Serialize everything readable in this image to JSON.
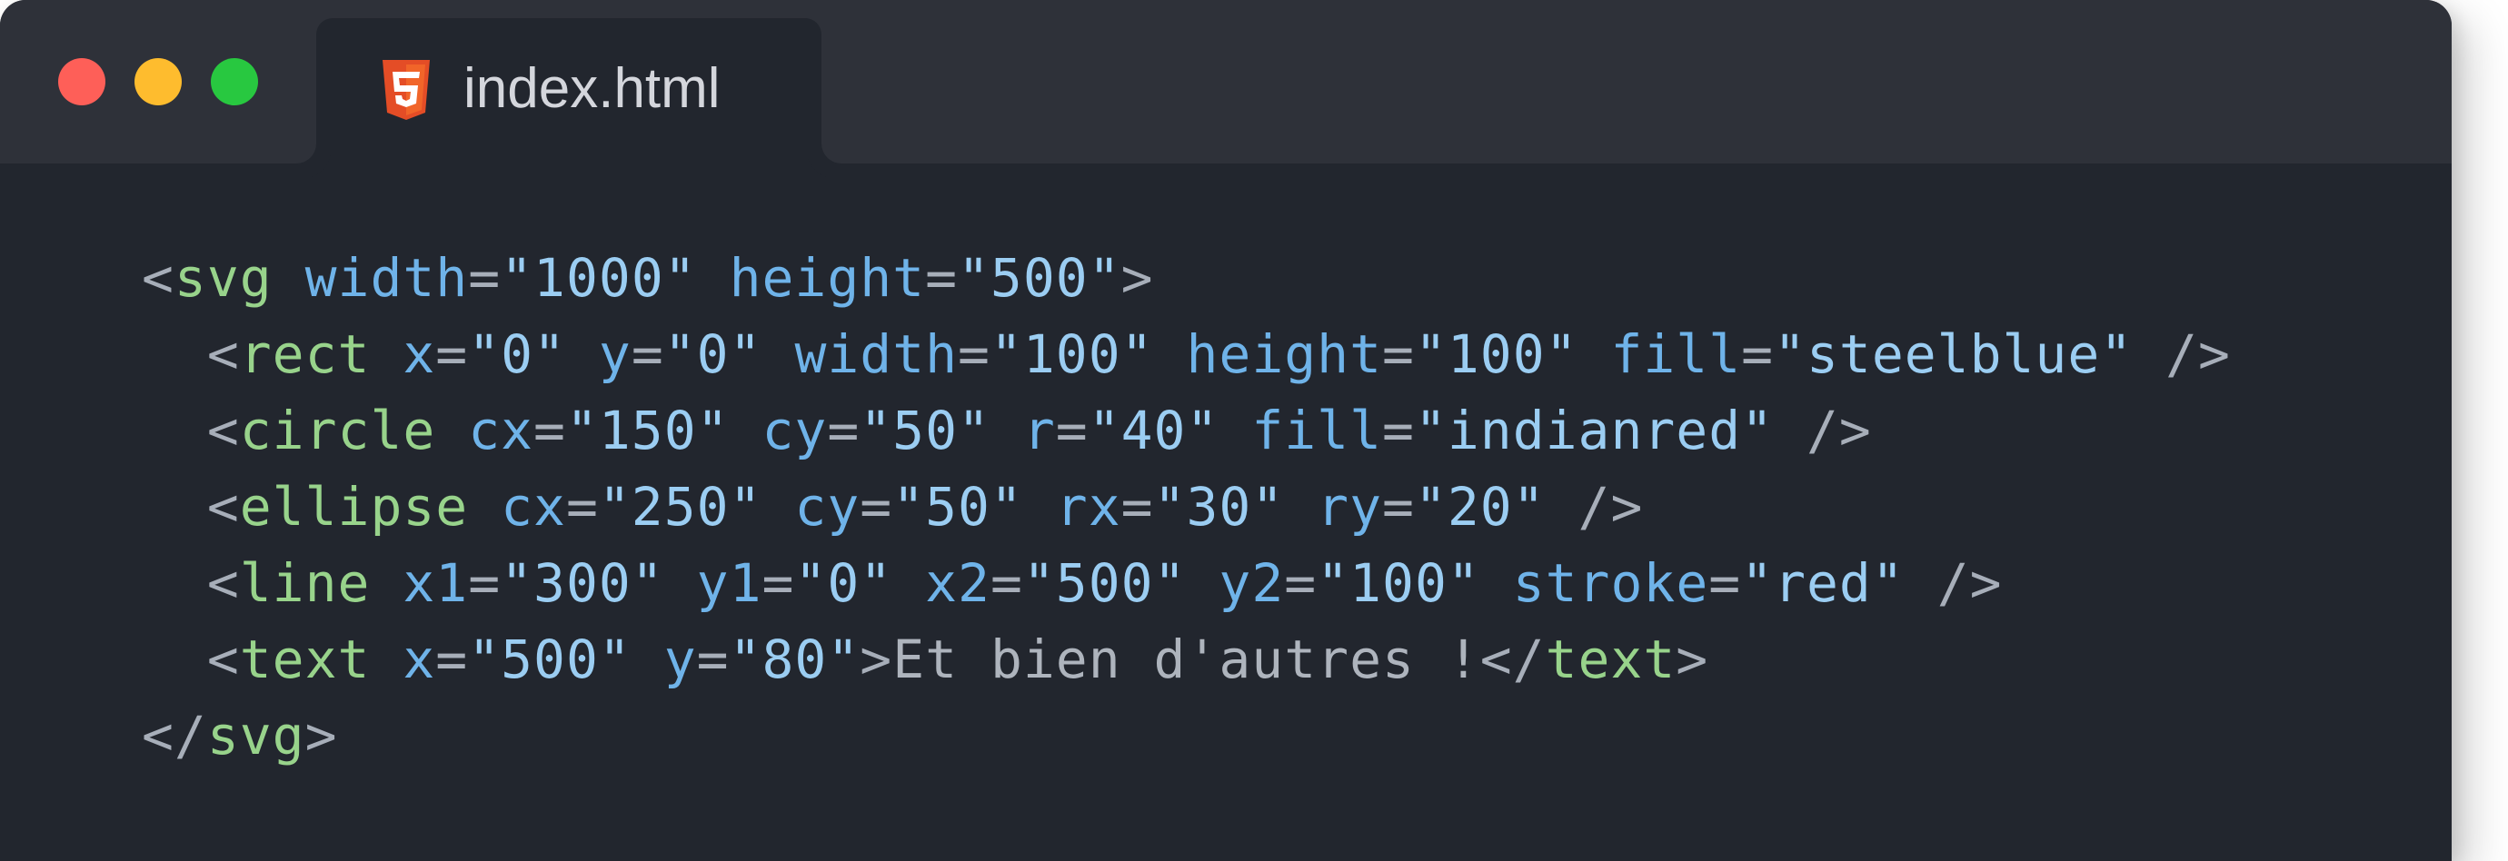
{
  "window": {
    "controls": [
      "close",
      "minimize",
      "maximize"
    ],
    "colors": {
      "close": "#fe5f58",
      "minimize": "#febc2e",
      "maximize": "#28c840",
      "background": "#22262e",
      "titlebar": "#2e3139"
    }
  },
  "tab": {
    "icon": "html5-icon",
    "title": "index.html"
  },
  "code": {
    "lines": [
      [
        {
          "k": "p",
          "v": "<"
        },
        {
          "k": "t",
          "v": "svg"
        },
        {
          "k": "x",
          "v": " "
        },
        {
          "k": "a",
          "v": "width"
        },
        {
          "k": "p",
          "v": "="
        },
        {
          "k": "s",
          "v": "\"1000\""
        },
        {
          "k": "x",
          "v": " "
        },
        {
          "k": "a",
          "v": "height"
        },
        {
          "k": "p",
          "v": "="
        },
        {
          "k": "s",
          "v": "\"500\""
        },
        {
          "k": "p",
          "v": ">"
        }
      ],
      [
        {
          "k": "x",
          "v": "  "
        },
        {
          "k": "p",
          "v": "<"
        },
        {
          "k": "t",
          "v": "rect"
        },
        {
          "k": "x",
          "v": " "
        },
        {
          "k": "a",
          "v": "x"
        },
        {
          "k": "p",
          "v": "="
        },
        {
          "k": "s",
          "v": "\"0\""
        },
        {
          "k": "x",
          "v": " "
        },
        {
          "k": "a",
          "v": "y"
        },
        {
          "k": "p",
          "v": "="
        },
        {
          "k": "s",
          "v": "\"0\""
        },
        {
          "k": "x",
          "v": " "
        },
        {
          "k": "a",
          "v": "width"
        },
        {
          "k": "p",
          "v": "="
        },
        {
          "k": "s",
          "v": "\"100\""
        },
        {
          "k": "x",
          "v": " "
        },
        {
          "k": "a",
          "v": "height"
        },
        {
          "k": "p",
          "v": "="
        },
        {
          "k": "s",
          "v": "\"100\""
        },
        {
          "k": "x",
          "v": " "
        },
        {
          "k": "a",
          "v": "fill"
        },
        {
          "k": "p",
          "v": "="
        },
        {
          "k": "s",
          "v": "\"steelblue\""
        },
        {
          "k": "x",
          "v": " "
        },
        {
          "k": "p",
          "v": "/>"
        }
      ],
      [
        {
          "k": "x",
          "v": "  "
        },
        {
          "k": "p",
          "v": "<"
        },
        {
          "k": "t",
          "v": "circle"
        },
        {
          "k": "x",
          "v": " "
        },
        {
          "k": "a",
          "v": "cx"
        },
        {
          "k": "p",
          "v": "="
        },
        {
          "k": "s",
          "v": "\"150\""
        },
        {
          "k": "x",
          "v": " "
        },
        {
          "k": "a",
          "v": "cy"
        },
        {
          "k": "p",
          "v": "="
        },
        {
          "k": "s",
          "v": "\"50\""
        },
        {
          "k": "x",
          "v": " "
        },
        {
          "k": "a",
          "v": "r"
        },
        {
          "k": "p",
          "v": "="
        },
        {
          "k": "s",
          "v": "\"40\""
        },
        {
          "k": "x",
          "v": " "
        },
        {
          "k": "a",
          "v": "fill"
        },
        {
          "k": "p",
          "v": "="
        },
        {
          "k": "s",
          "v": "\"indianred\""
        },
        {
          "k": "x",
          "v": " "
        },
        {
          "k": "p",
          "v": "/>"
        }
      ],
      [
        {
          "k": "x",
          "v": "  "
        },
        {
          "k": "p",
          "v": "<"
        },
        {
          "k": "t",
          "v": "ellipse"
        },
        {
          "k": "x",
          "v": " "
        },
        {
          "k": "a",
          "v": "cx"
        },
        {
          "k": "p",
          "v": "="
        },
        {
          "k": "s",
          "v": "\"250\""
        },
        {
          "k": "x",
          "v": " "
        },
        {
          "k": "a",
          "v": "cy"
        },
        {
          "k": "p",
          "v": "="
        },
        {
          "k": "s",
          "v": "\"50\""
        },
        {
          "k": "x",
          "v": " "
        },
        {
          "k": "a",
          "v": "rx"
        },
        {
          "k": "p",
          "v": "="
        },
        {
          "k": "s",
          "v": "\"30\""
        },
        {
          "k": "x",
          "v": " "
        },
        {
          "k": "a",
          "v": "ry"
        },
        {
          "k": "p",
          "v": "="
        },
        {
          "k": "s",
          "v": "\"20\""
        },
        {
          "k": "x",
          "v": " "
        },
        {
          "k": "p",
          "v": "/>"
        }
      ],
      [
        {
          "k": "x",
          "v": "  "
        },
        {
          "k": "p",
          "v": "<"
        },
        {
          "k": "t",
          "v": "line"
        },
        {
          "k": "x",
          "v": " "
        },
        {
          "k": "a",
          "v": "x1"
        },
        {
          "k": "p",
          "v": "="
        },
        {
          "k": "s",
          "v": "\"300\""
        },
        {
          "k": "x",
          "v": " "
        },
        {
          "k": "a",
          "v": "y1"
        },
        {
          "k": "p",
          "v": "="
        },
        {
          "k": "s",
          "v": "\"0\""
        },
        {
          "k": "x",
          "v": " "
        },
        {
          "k": "a",
          "v": "x2"
        },
        {
          "k": "p",
          "v": "="
        },
        {
          "k": "s",
          "v": "\"500\""
        },
        {
          "k": "x",
          "v": " "
        },
        {
          "k": "a",
          "v": "y2"
        },
        {
          "k": "p",
          "v": "="
        },
        {
          "k": "s",
          "v": "\"100\""
        },
        {
          "k": "x",
          "v": " "
        },
        {
          "k": "a",
          "v": "stroke"
        },
        {
          "k": "p",
          "v": "="
        },
        {
          "k": "s",
          "v": "\"red\""
        },
        {
          "k": "x",
          "v": " "
        },
        {
          "k": "p",
          "v": "/>"
        }
      ],
      [
        {
          "k": "x",
          "v": "  "
        },
        {
          "k": "p",
          "v": "<"
        },
        {
          "k": "t",
          "v": "text"
        },
        {
          "k": "x",
          "v": " "
        },
        {
          "k": "a",
          "v": "x"
        },
        {
          "k": "p",
          "v": "="
        },
        {
          "k": "s",
          "v": "\"500\""
        },
        {
          "k": "x",
          "v": " "
        },
        {
          "k": "a",
          "v": "y"
        },
        {
          "k": "p",
          "v": "="
        },
        {
          "k": "s",
          "v": "\"80\""
        },
        {
          "k": "p",
          "v": ">"
        },
        {
          "k": "x",
          "v": "Et bien d'autres !"
        },
        {
          "k": "p",
          "v": "</"
        },
        {
          "k": "t",
          "v": "text"
        },
        {
          "k": "p",
          "v": ">"
        }
      ],
      [
        {
          "k": "p",
          "v": "</"
        },
        {
          "k": "t",
          "v": "svg"
        },
        {
          "k": "p",
          "v": ">"
        }
      ]
    ]
  }
}
